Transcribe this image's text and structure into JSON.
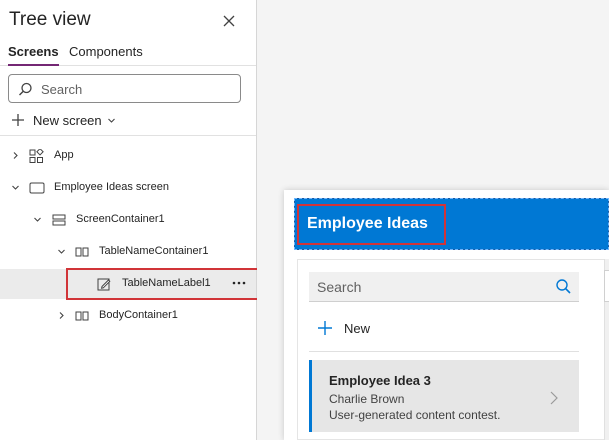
{
  "panel": {
    "title": "Tree view",
    "tabs": [
      {
        "label": "Screens",
        "active": true
      },
      {
        "label": "Components",
        "active": false
      }
    ],
    "search_placeholder": "Search",
    "new_screen_label": "New screen"
  },
  "tree": {
    "app": "App",
    "screen": "Employee Ideas screen",
    "screen_container": "ScreenContainer1",
    "table_name_container": "TableNameContainer1",
    "table_name_label": "TableNameLabel1",
    "body_container": "BodyContainer1"
  },
  "canvas": {
    "header_title": "Employee Ideas",
    "search_placeholder": "Search",
    "new_label": "New",
    "idea": {
      "title": "Employee Idea 3",
      "author": "Charlie Brown",
      "description": "User-generated content contest."
    }
  },
  "colors": {
    "accent": "#742774",
    "header_blue": "#0078d4",
    "selection_red": "#d13438"
  },
  "icons": [
    "close-icon",
    "search-icon",
    "plus-icon",
    "chevron-down-icon",
    "chevron-right-icon",
    "app-icon",
    "screen-icon",
    "container-icon",
    "horizontal-container-icon",
    "label-edit-icon",
    "more-icon"
  ]
}
